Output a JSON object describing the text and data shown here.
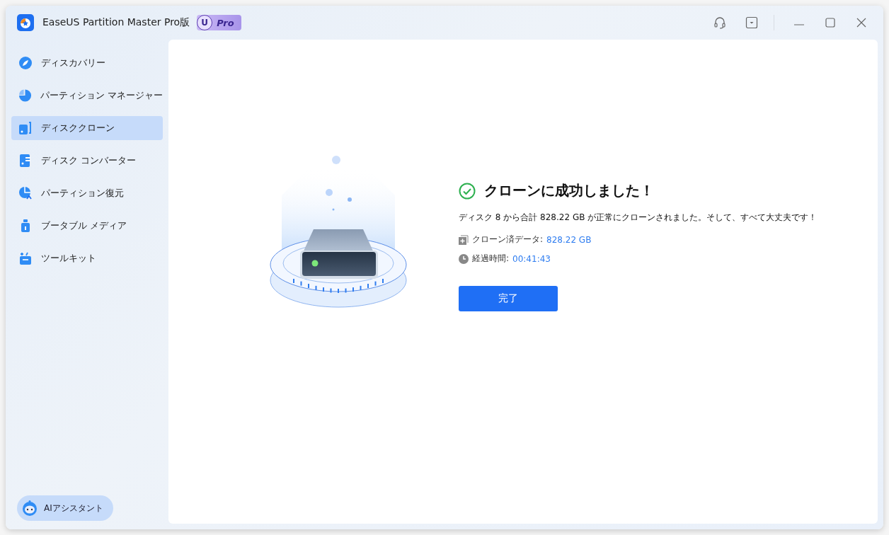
{
  "window": {
    "title": "EaseUS Partition Master Pro版",
    "badge": {
      "letter": "U",
      "label": "Pro"
    }
  },
  "sidebar": {
    "items": [
      {
        "label": "ディスカバリー",
        "selected": false,
        "kind": "discovery"
      },
      {
        "label": "パーティション マネージャー",
        "selected": false,
        "kind": "partition"
      },
      {
        "label": "ディスククローン",
        "selected": true,
        "kind": "clone"
      },
      {
        "label": "ディスク コンバーター",
        "selected": false,
        "kind": "converter"
      },
      {
        "label": "パーティション復元",
        "selected": false,
        "kind": "recovery"
      },
      {
        "label": "ブータブル メディア",
        "selected": false,
        "kind": "bootable"
      },
      {
        "label": "ツールキット",
        "selected": false,
        "kind": "toolkit"
      }
    ],
    "assistant_button": "AIアシスタント"
  },
  "result": {
    "title": "クローンに成功しました！",
    "message": "ディスク 8 から合計 828.22 GB が正常にクローンされました。そして、すべて大丈夫です！",
    "stats": [
      {
        "kind": "data",
        "label": "クローン済データ:",
        "value": "828.22 GB"
      },
      {
        "kind": "time",
        "label": "経過時間:",
        "value": "00:41:43"
      }
    ],
    "button": "完了"
  }
}
